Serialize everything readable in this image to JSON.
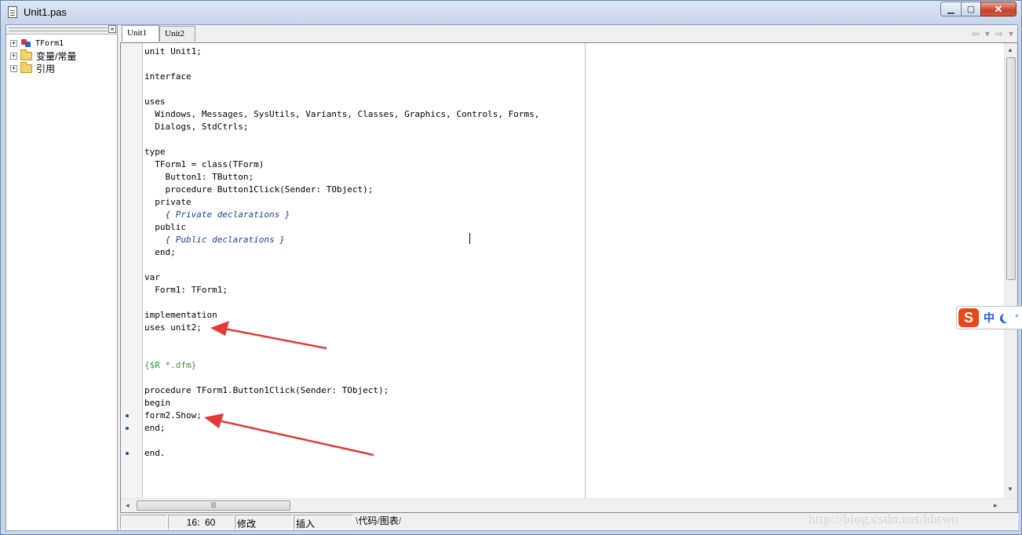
{
  "window": {
    "title": "Unit1.pas"
  },
  "tree": {
    "items": [
      {
        "label": "TForm1",
        "icon": "form-icon"
      },
      {
        "label": "变量/常量",
        "icon": "folder-icon"
      },
      {
        "label": "引用",
        "icon": "folder-icon"
      }
    ]
  },
  "tabs": [
    {
      "label": "Unit1"
    },
    {
      "label": "Unit2"
    }
  ],
  "code": {
    "lines": [
      "unit Unit1;",
      "",
      "interface",
      "",
      "uses",
      "  Windows, Messages, SysUtils, Variants, Classes, Graphics, Controls, Forms,",
      "  Dialogs, StdCtrls;",
      "",
      "type",
      "  TForm1 = class(TForm)",
      "    Button1: TButton;",
      "    procedure Button1Click(Sender: TObject);",
      "  private",
      "    { Private declarations }",
      "  public",
      "    { Public declarations }",
      "  end;",
      "",
      "var",
      "  Form1: TForm1;",
      "",
      "implementation",
      "uses unit2;",
      "",
      "",
      "{$R *.dfm}",
      "",
      "procedure TForm1.Button1Click(Sender: TObject);",
      "begin",
      "form2.Show;",
      "end;",
      "",
      "end."
    ],
    "breakpoint_lines": [
      30,
      31,
      33
    ]
  },
  "status": {
    "position": "16:  60",
    "modified": "修改",
    "mode": "插入",
    "sheet_code": "代码",
    "sheet_diagram": "图表"
  },
  "ime": {
    "logo": "S",
    "lang": "中"
  },
  "watermark": "http://blog.csdn.net/hbtwo",
  "colors": {
    "comment": "#1e3f9e",
    "directive": "#3a9a3a",
    "arrow": "#e53935"
  }
}
